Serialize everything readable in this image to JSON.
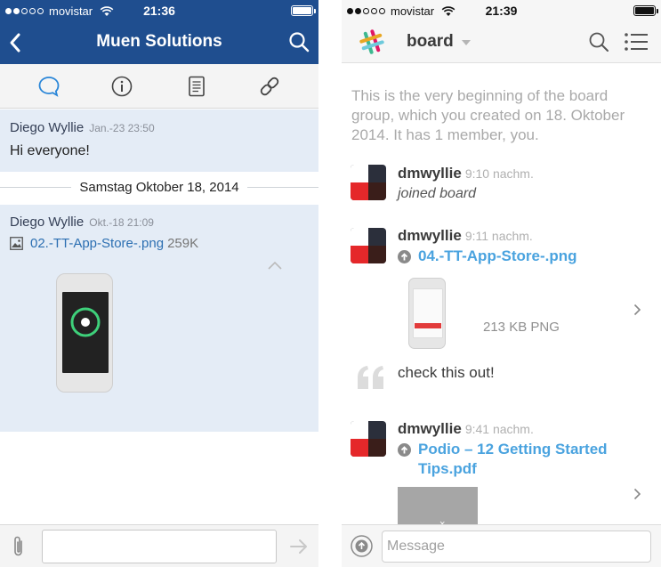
{
  "left": {
    "status": {
      "carrier": "movistar",
      "time": "21:36"
    },
    "nav": {
      "title": "Muen Solutions"
    },
    "tabs": [
      "chat-icon",
      "info-icon",
      "document-icon",
      "link-icon"
    ],
    "messages": [
      {
        "author": "Diego Wyllie",
        "time": "Jan.-23 23:50",
        "text": "Hi everyone!"
      },
      {
        "author": "Diego Wyllie",
        "time": "Okt.-18 21:09",
        "file_name": "02.-TT-App-Store-.png",
        "file_size": "259K"
      }
    ],
    "date_divider": "Samstag Oktober 18, 2014",
    "composer": {
      "placeholder": ""
    },
    "colors": {
      "nav_bg": "#1f4e8f",
      "bubble_bg": "#e4ecf6",
      "link": "#2c6fb2"
    }
  },
  "right": {
    "status": {
      "carrier": "movistar",
      "time": "21:39"
    },
    "nav": {
      "channel": "board"
    },
    "intro": "This is the very beginning of the board group, which you created on 18. Oktober 2014. It has 1 member, you.",
    "messages": [
      {
        "user": "dmwyllie",
        "time": "9:10 nachm.",
        "text": "joined board"
      },
      {
        "user": "dmwyllie",
        "time": "9:11 nachm.",
        "file_name": "04.-TT-App-Store-.png",
        "file_meta": "213 KB PNG",
        "comment": "check this out!"
      },
      {
        "user": "dmwyllie",
        "time": "9:41 nachm.",
        "file_name": "Podio – 12 Getting Started Tips.pdf"
      }
    ],
    "composer": {
      "placeholder": "Message"
    },
    "colors": {
      "link": "#4aa3df",
      "text": "#3a3a3a",
      "muted": "#a9a9a9"
    }
  }
}
